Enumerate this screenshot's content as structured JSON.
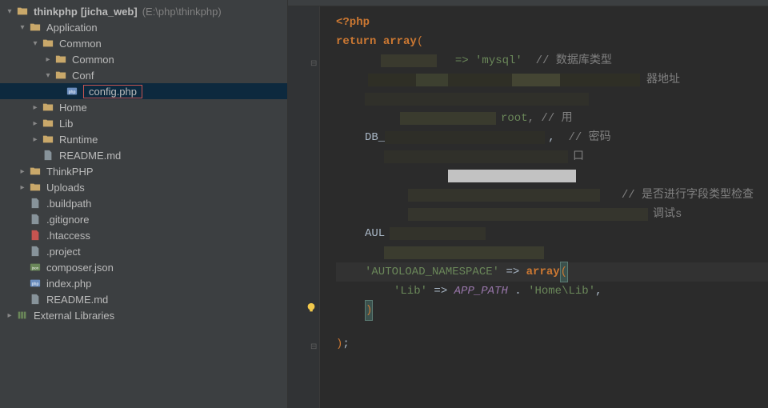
{
  "project": {
    "root_name": "thinkphp",
    "root_qualifier": "[jicha_web]",
    "root_path": "(E:\\php\\thinkphp)"
  },
  "tree": {
    "application": "Application",
    "common": "Common",
    "common2": "Common",
    "conf": "Conf",
    "config": "config.php",
    "home": "Home",
    "lib": "Lib",
    "runtime": "Runtime",
    "readme1": "README.md",
    "thinkphp": "ThinkPHP",
    "uploads": "Uploads",
    "buildpath": ".buildpath",
    "gitignore": ".gitignore",
    "htaccess": ".htaccess",
    "project": ".project",
    "composer": "composer.json",
    "index": "index.php",
    "readme2": "README.md",
    "external": "External Libraries"
  },
  "code": {
    "php_open": "<?php",
    "return": "return",
    "array": "array",
    "paren_open": "(",
    "c_dbtype": "// 数据库类型",
    "c_addr": "器地址",
    "c_pwd": "// 密码",
    "c_check": "// 是否进行字段类型检查",
    "c_debug": "调试s",
    "autoload_key": "'AUTOLOAD_NAMESPACE'",
    "arrow": "=>",
    "lib_key": "'Lib'",
    "app_path": "APP_PATH",
    "dot": " . ",
    "lib_val": "'Home\\Lib'",
    "close_paren": ")",
    "semi": ";",
    "mysql_frag": "=> 'mysql'",
    "root_frag": ", // 用",
    "aul_frag": "AUL"
  }
}
